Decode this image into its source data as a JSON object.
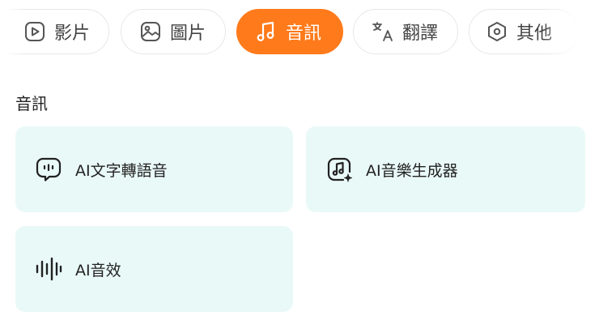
{
  "tabs": [
    {
      "label": "影片",
      "icon": "video-play-icon",
      "active": false
    },
    {
      "label": "圖片",
      "icon": "image-icon",
      "active": false
    },
    {
      "label": "音訊",
      "icon": "music-note-icon",
      "active": true
    },
    {
      "label": "翻譯",
      "icon": "translate-icon",
      "active": false
    },
    {
      "label": "其他",
      "icon": "hexagon-icon",
      "active": false
    }
  ],
  "section": {
    "title": "音訊"
  },
  "cards": [
    {
      "label": "AI文字轉語音",
      "icon": "speech-bubble-icon"
    },
    {
      "label": "AI音樂生成器",
      "icon": "music-sparkle-icon"
    },
    {
      "label": "AI音效",
      "icon": "sound-wave-icon"
    }
  ],
  "colors": {
    "accent": "#ff7a1a",
    "card_bg": "#e9f9f7",
    "tab_border": "#e4e7ea"
  }
}
